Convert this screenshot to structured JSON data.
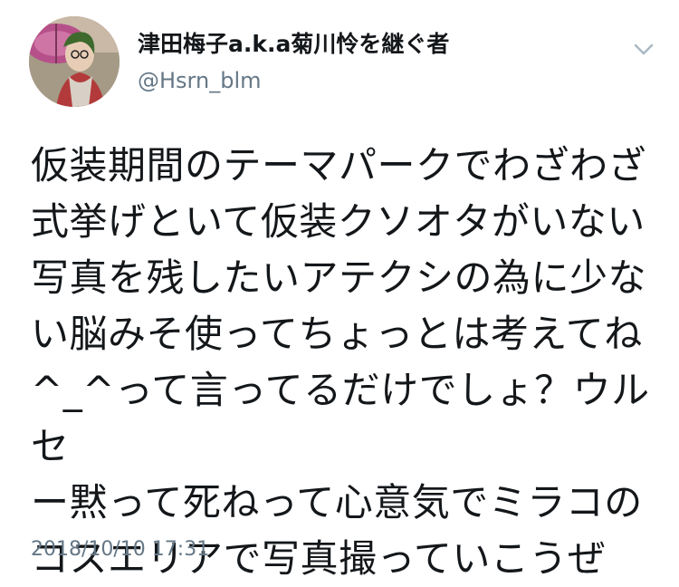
{
  "tweet": {
    "author": {
      "display_name": "津田梅子a.k.a菊川怜を継ぐ者",
      "handle": "@Hsrn_blm",
      "avatar_icon": "user-avatar-icon"
    },
    "menu_icon": "chevron-down-icon",
    "text": "仮装期間のテーマパークでわざわざ\n式挙げといて仮装クソオタがいない\n写真を残したいアテクシの為に少な\nい脳みそ使ってちょっとは考えてね\n^_^って言ってるだけでしょ？ウルセ\nー黙って死ねって心意気でミラコの\nコスエリアで写真撮っていこうぜ",
    "timestamp": "2018/10/10 17:31"
  },
  "colors": {
    "text_primary": "#14171a",
    "text_secondary": "#657786",
    "chevron": "#aab8c2",
    "background": "#ffffff"
  }
}
